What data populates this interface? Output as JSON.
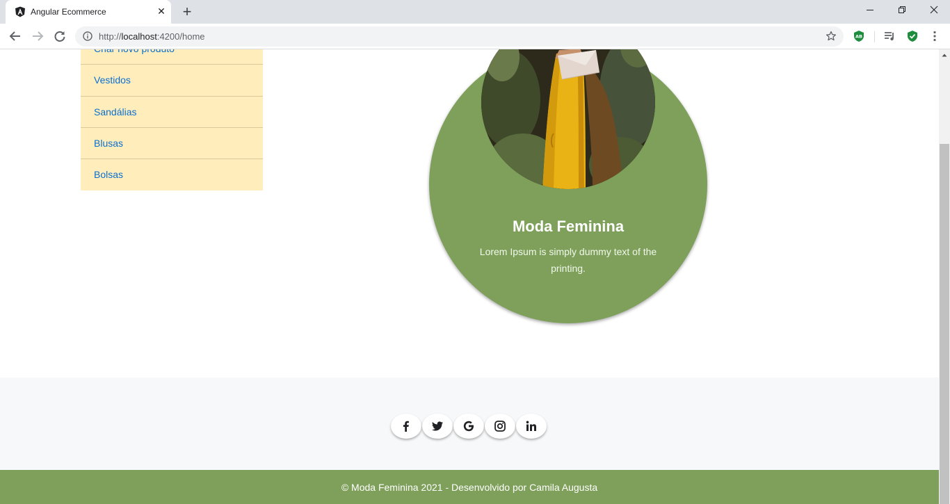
{
  "browser": {
    "tab_title": "Angular Ecommerce",
    "close_glyph": "✕",
    "new_tab_glyph": "+",
    "url_prefix": "http://",
    "url_host": "localhost",
    "url_path": ":4200/home",
    "icons": [
      "angular-favicon-icon",
      "back-icon",
      "forward-icon",
      "reload-icon",
      "info-icon",
      "star-icon",
      "adblock-icon",
      "media-icon",
      "shield-icon",
      "kebab-menu-icon",
      "minimize-icon",
      "restore-icon",
      "close-icon"
    ]
  },
  "sidebar": {
    "items": [
      {
        "label": "Criar novo produto"
      },
      {
        "label": "Vestidos"
      },
      {
        "label": "Sandálias"
      },
      {
        "label": "Blusas"
      },
      {
        "label": "Bolsas"
      }
    ]
  },
  "card": {
    "title": "Moda Feminina",
    "text": "Lorem Ipsum is simply dummy text of the printing."
  },
  "social": {
    "icons": [
      "facebook-icon",
      "twitter-icon",
      "google-icon",
      "instagram-icon",
      "linkedin-icon"
    ]
  },
  "footer": {
    "copyright": "© Moda Feminina 2021 - Desenvolvido por Camila Augusta"
  },
  "colors": {
    "accent_green": "#7ea05a",
    "sidebar_bg": "#ffeebb",
    "link_blue": "#0a6ed1",
    "footer_bg": "#f7f8f9"
  }
}
